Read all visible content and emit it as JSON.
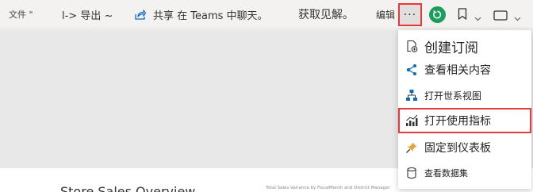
{
  "toolbar": {
    "file_label": "文件 \"",
    "export_label": "l-> 导出 ~",
    "share_label": "共享 在 Teams 中聊天。",
    "insights_label": "获取见解。",
    "edit_label": "编辑",
    "more_label": "···",
    "accent_color": "#e8393a",
    "reset_color": "#1a9e5c"
  },
  "menu": {
    "items": [
      {
        "label": "创建订阅",
        "icon": "subscribe-icon"
      },
      {
        "label": "查看相关内容",
        "icon": "related-content-icon"
      },
      {
        "label": "打开世系视图",
        "icon": "lineage-icon"
      },
      {
        "label": "打开使用指标",
        "icon": "usage-metrics-icon"
      },
      {
        "label": "固定到仪表板",
        "icon": "pin-icon"
      },
      {
        "label": "查看数据集",
        "icon": "dataset-icon"
      }
    ]
  },
  "report": {
    "title": "Store Sales Overview",
    "chart_caption": "Total Sales Variance by FiscalMonth and District Manager"
  }
}
